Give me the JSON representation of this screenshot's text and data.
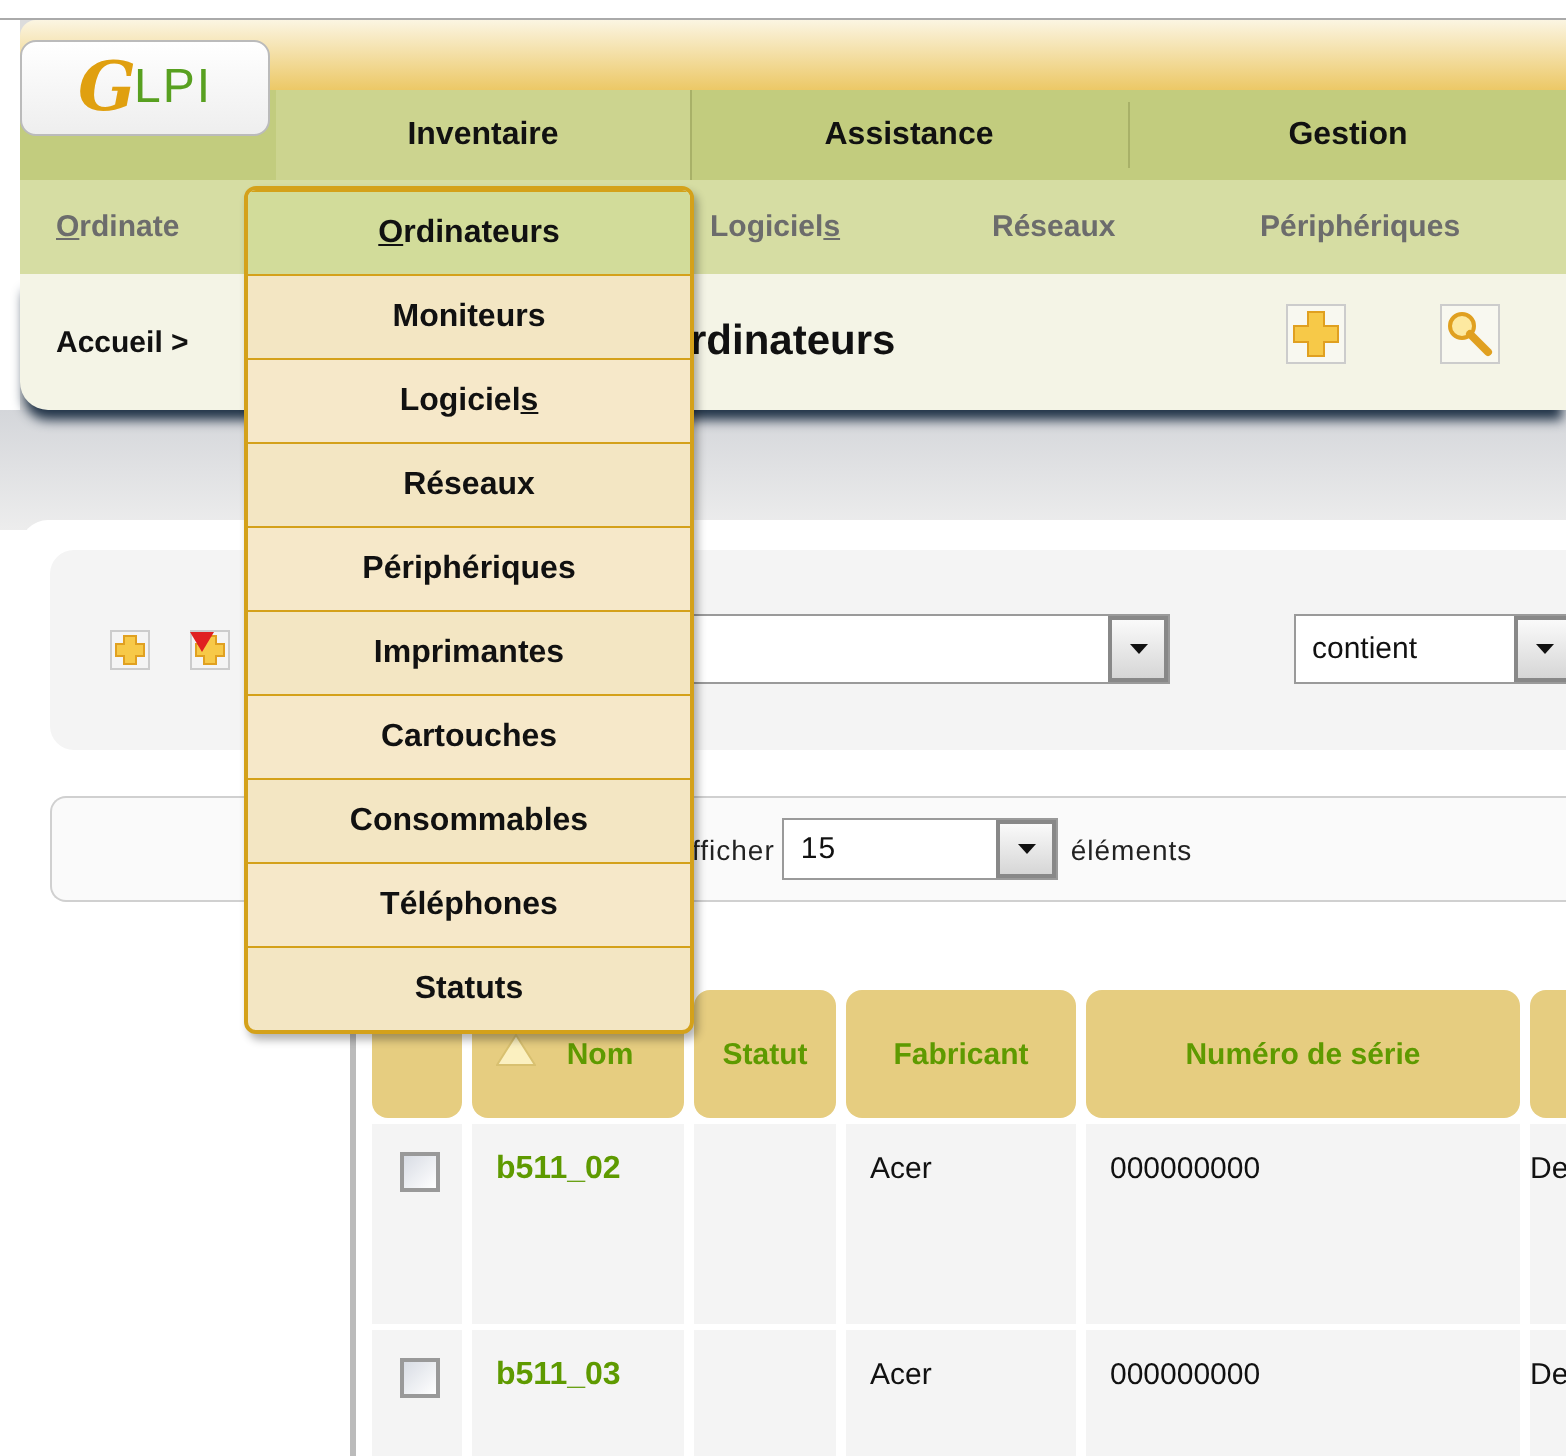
{
  "header": {
    "logo": "GLPI",
    "main_menu": [
      {
        "label": "Inventaire",
        "selected": true
      },
      {
        "label": "Assistance",
        "selected": false
      },
      {
        "label": "Gestion",
        "selected": false
      }
    ],
    "sub_menu": [
      {
        "parts": [
          {
            "text": "O",
            "underlined": true
          },
          {
            "text": "rdinate",
            "underlined": false
          }
        ]
      },
      {
        "parts": [
          {
            "text": "Logiciel",
            "underlined": false
          },
          {
            "text": "s",
            "underlined": true
          }
        ]
      },
      {
        "label": "Réseaux"
      },
      {
        "label": "Périphériques"
      }
    ],
    "breadcrumb": "Accueil >",
    "title": "rdinateurs"
  },
  "search": {
    "operator": "contient"
  },
  "pager": {
    "label": "fficher",
    "per_page": "15",
    "suffix": "éléments"
  },
  "dropdown_menu": [
    {
      "parts": [
        {
          "text": "O",
          "underlined": true
        },
        {
          "text": "rdinateurs",
          "underlined": false
        }
      ],
      "selected": true
    },
    {
      "label": "Moniteurs",
      "selected": false
    },
    {
      "parts": [
        {
          "text": "Logiciel",
          "underlined": false
        },
        {
          "text": "s",
          "underlined": true
        }
      ],
      "selected": false
    },
    {
      "label": "Réseaux",
      "selected": false
    },
    {
      "label": "Périphériques",
      "selected": false
    },
    {
      "label": "Imprimantes",
      "selected": false
    },
    {
      "label": "Cartouches",
      "selected": false
    },
    {
      "label": "Consommables",
      "selected": false
    },
    {
      "label": "Téléphones",
      "selected": false
    },
    {
      "label": "Statuts",
      "selected": false
    }
  ],
  "table": {
    "columns": [
      {
        "label": "Nom",
        "sorted": true
      },
      {
        "label": "Statut",
        "sorted": false
      },
      {
        "label": "Fabricant",
        "sorted": false
      },
      {
        "label": "Numéro de série",
        "sorted": false
      }
    ],
    "rows": [
      {
        "checked": false,
        "name": "b511_02",
        "manufacturer": "Acer",
        "serial": "000000000",
        "column_5": "De"
      },
      {
        "checked": false,
        "name": "b511_03",
        "manufacturer": "Acer",
        "serial": "000000000",
        "column_5": "De"
      }
    ]
  }
}
